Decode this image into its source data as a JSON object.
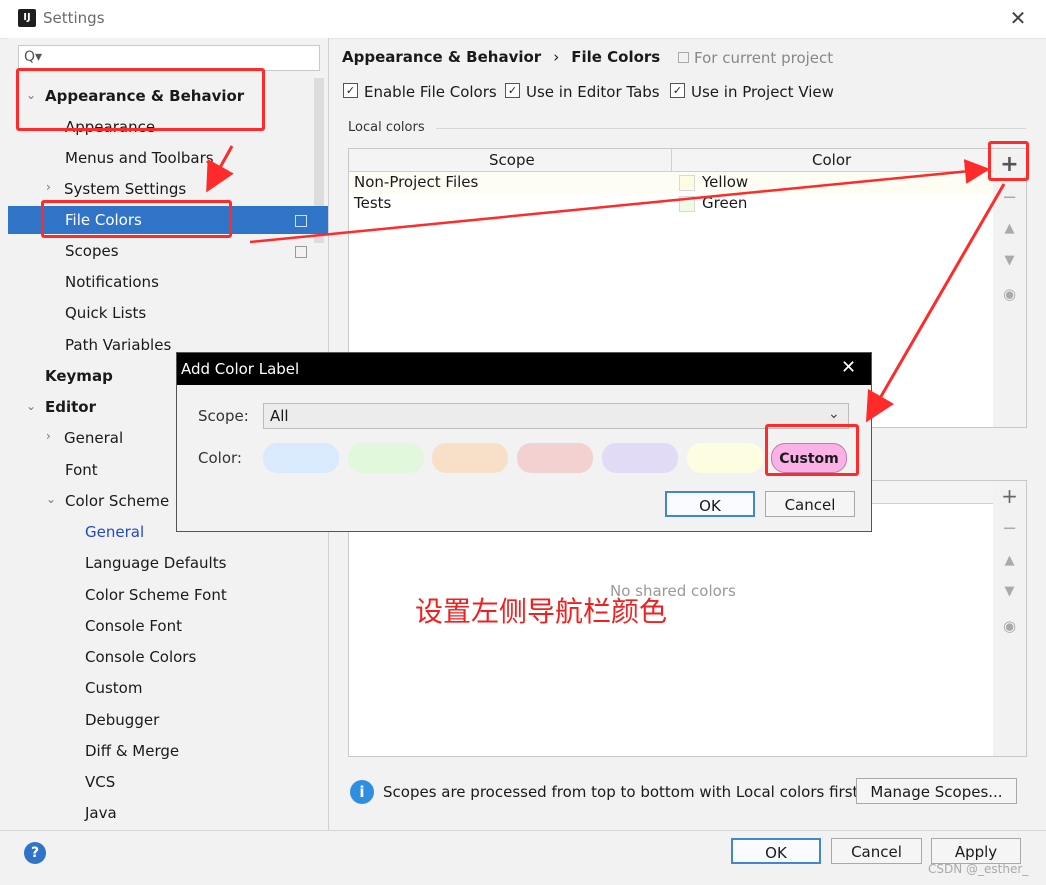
{
  "window": {
    "title": "Settings",
    "app_icon": "intellij-icon",
    "close": "✕"
  },
  "sidebar": {
    "search_placeholder": "Q▾",
    "items": [
      {
        "label": "Appearance & Behavior",
        "bold": true,
        "expanded": true
      },
      {
        "label": "Appearance"
      },
      {
        "label": "Menus and Toolbars"
      },
      {
        "label": "System Settings",
        "collapsed": true
      },
      {
        "label": "File Colors",
        "selected": true
      },
      {
        "label": "Scopes"
      },
      {
        "label": "Notifications"
      },
      {
        "label": "Quick Lists"
      },
      {
        "label": "Path Variables"
      },
      {
        "label": "Keymap",
        "bold": true
      },
      {
        "label": "Editor",
        "bold": true,
        "expanded": true
      },
      {
        "label": "General",
        "collapsed": true
      },
      {
        "label": "Font"
      },
      {
        "label": "Color Scheme",
        "expanded": true
      },
      {
        "label": "General",
        "link": true
      },
      {
        "label": "Language Defaults"
      },
      {
        "label": "Color Scheme Font"
      },
      {
        "label": "Console Font"
      },
      {
        "label": "Console Colors"
      },
      {
        "label": "Custom"
      },
      {
        "label": "Debugger"
      },
      {
        "label": "Diff & Merge"
      },
      {
        "label": "VCS"
      },
      {
        "label": "Java"
      }
    ]
  },
  "main": {
    "breadcrumb": {
      "parent": "Appearance & Behavior",
      "separator": "›",
      "current": "File Colors"
    },
    "for_current_project": "For current project",
    "checkboxes": [
      {
        "label": "Enable File Colors",
        "checked": true
      },
      {
        "label": "Use in Editor Tabs",
        "checked": true
      },
      {
        "label": "Use in Project View",
        "checked": true
      }
    ],
    "local_colors_label": "Local colors",
    "local_table": {
      "headers": [
        "Scope",
        "Color"
      ],
      "rows": [
        {
          "scope": "Non-Project Files",
          "color": "Yellow",
          "swatch": "#fdfbe0"
        },
        {
          "scope": "Tests",
          "color": "Green",
          "swatch": "#eefbe9"
        }
      ]
    },
    "shared_empty": "No shared colors",
    "info_text": "Scopes are processed from top to bottom with Local colors first.",
    "manage_scopes": "Manage Scopes..."
  },
  "dialog": {
    "title": "Add Color Label",
    "close": "✕",
    "scope_label": "Scope:",
    "scope_value": "All",
    "color_label": "Color:",
    "swatches": [
      "#d8eafc",
      "#e1f8dc",
      "#f8dfc8",
      "#f3d1d1",
      "#e2dbf5",
      "#fdfde1"
    ],
    "custom_label": "Custom",
    "ok": "OK",
    "cancel": "Cancel"
  },
  "footer": {
    "help": "?",
    "ok": "OK",
    "cancel": "Cancel",
    "apply": "Apply"
  },
  "annotation": {
    "text": "设置左侧导航栏颜色",
    "color": "#f02020"
  },
  "watermark": "CSDN @_esther_",
  "colors": {
    "selection": "#2f74c7",
    "accent_red": "#ff2a2a"
  }
}
